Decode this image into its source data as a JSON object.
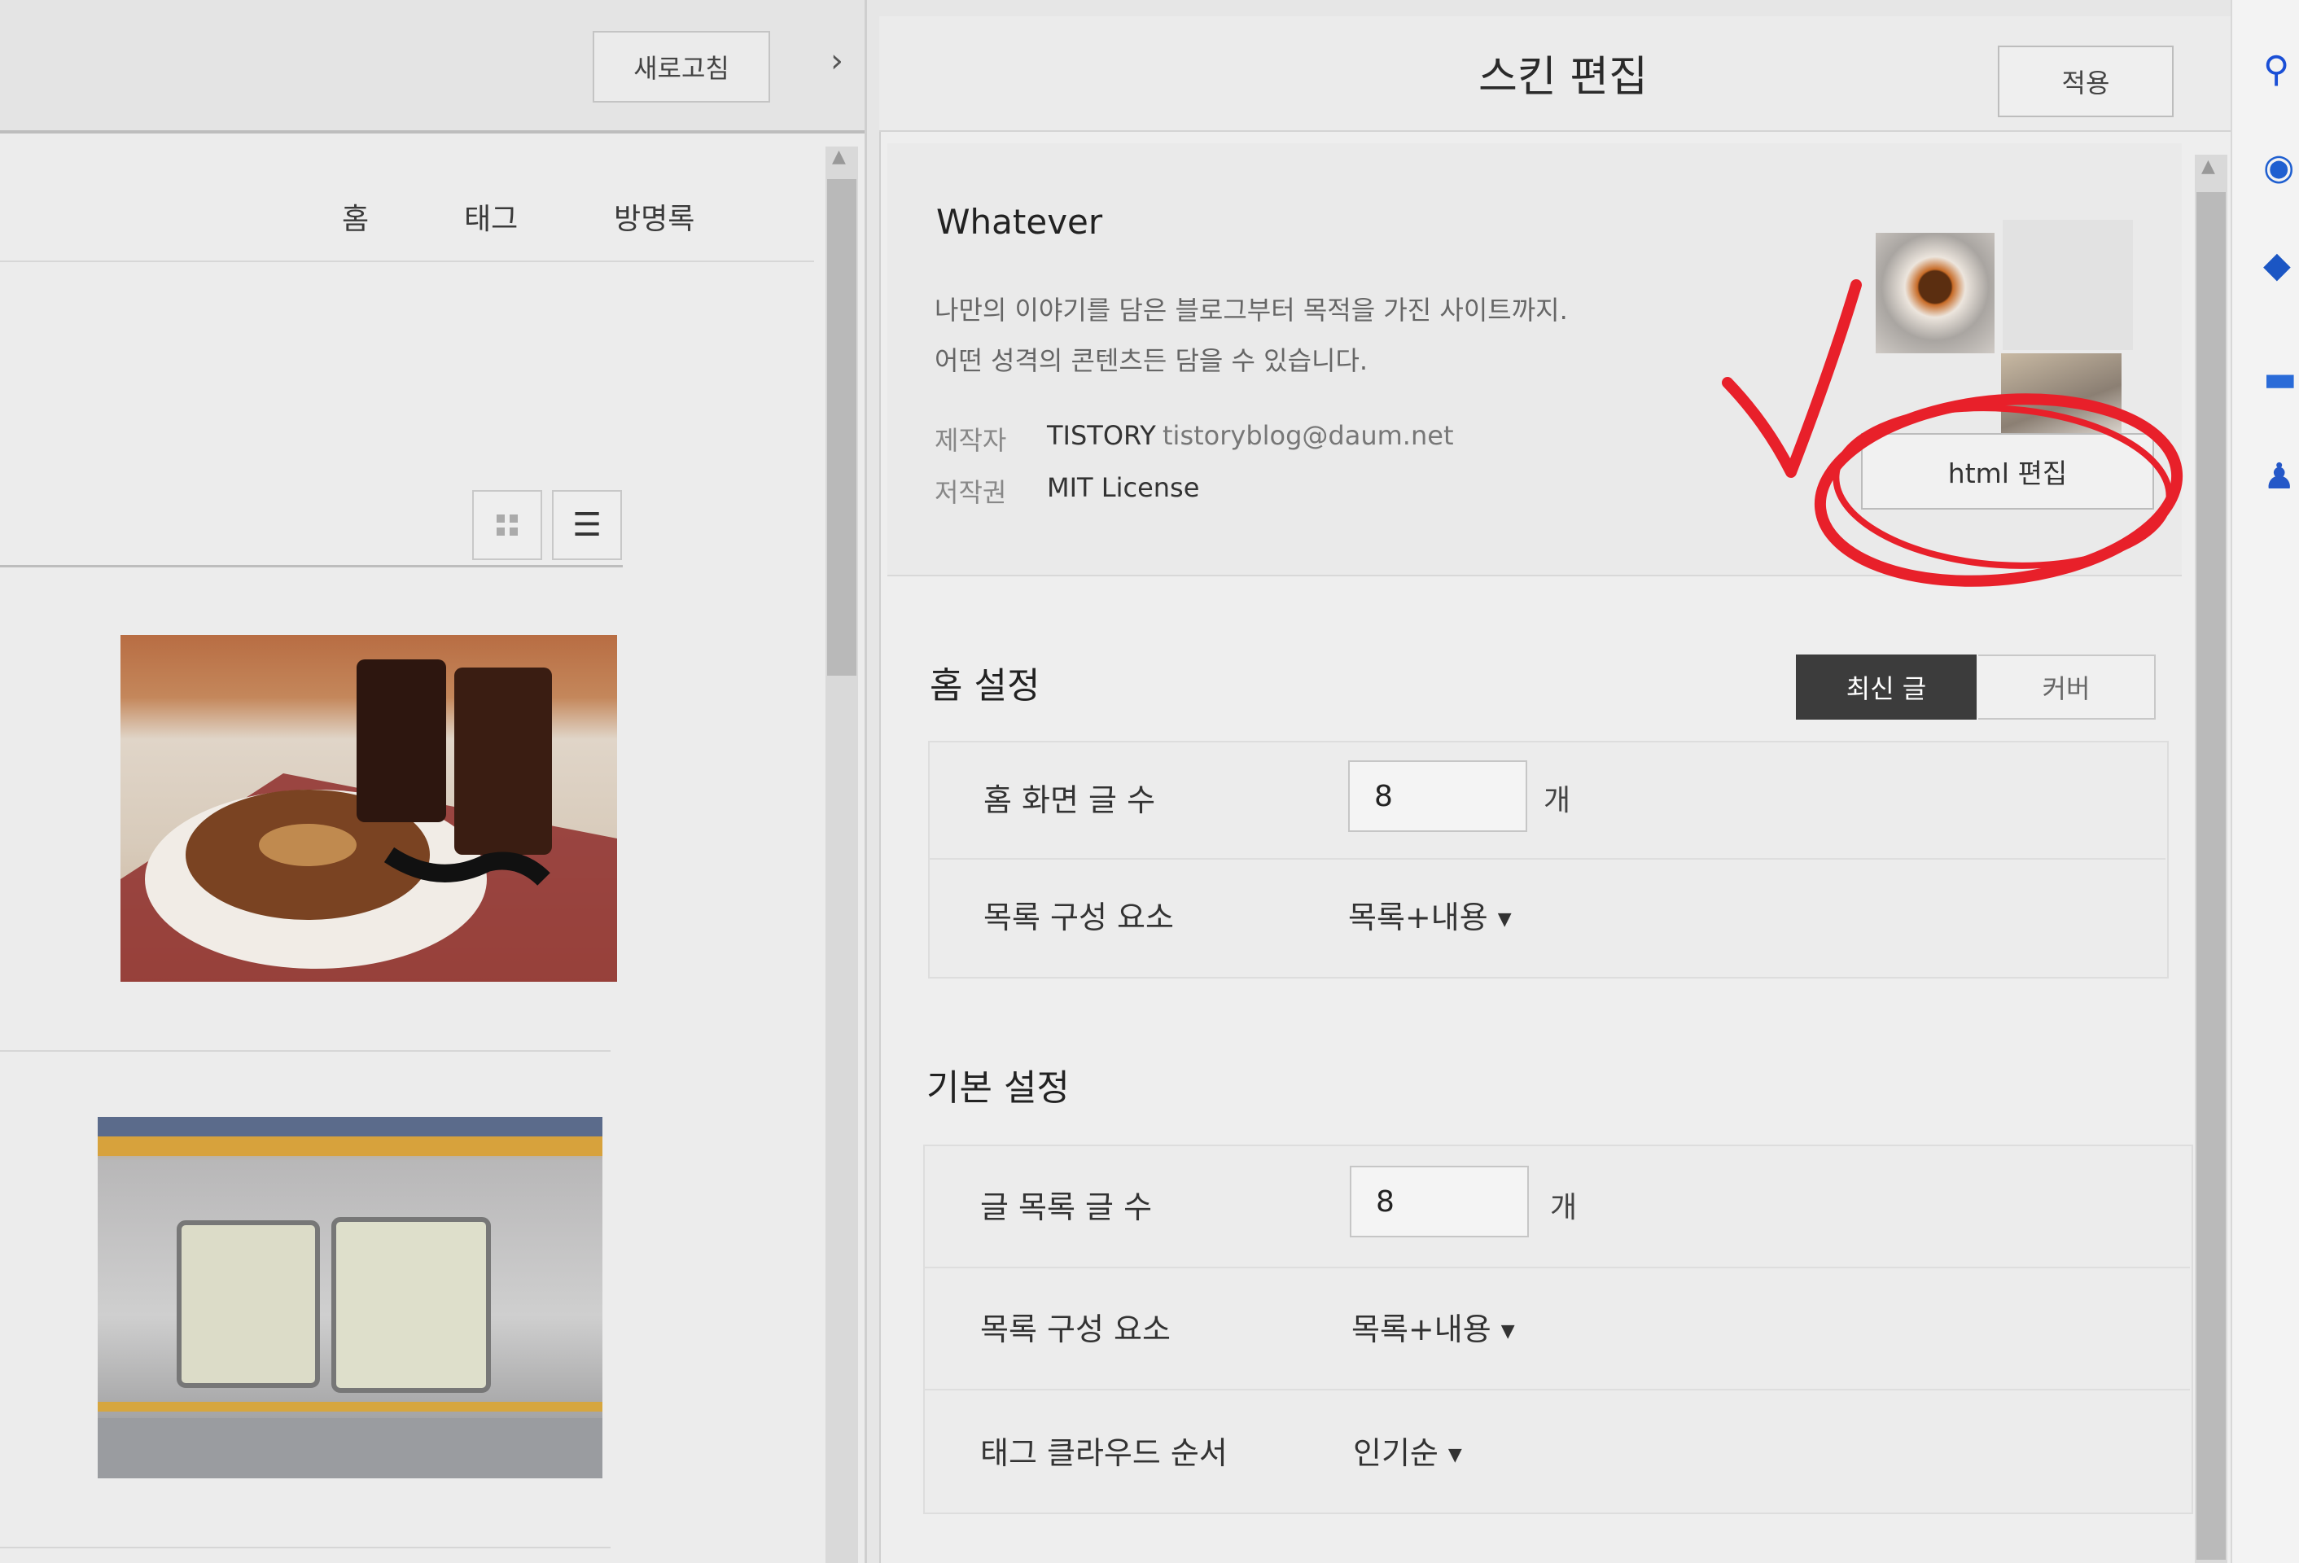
{
  "left": {
    "refresh_label": "새로고침",
    "collapse_icon": "chevron-right-icon",
    "nav": [
      "홈",
      "태그",
      "방명록"
    ],
    "view_grid_icon": "grid-icon",
    "view_list_icon": "list-icon"
  },
  "editor": {
    "title": "스킨 편집",
    "apply_label": "적용",
    "skin": {
      "name": "Whatever",
      "desc_line1": "나만의 이야기를 담은 블로그부터 목적을 가진 사이트까지.",
      "desc_line2": "어떤 성격의 콘텐츠든 담을 수 있습니다.",
      "author_label": "제작자",
      "author_value": "TISTORY",
      "author_email": "tistoryblog@daum.net",
      "copyright_label": "저작권",
      "copyright_value": "MIT License",
      "html_edit_label": "html 편집"
    },
    "home_settings": {
      "title": "홈 설정",
      "tabs": [
        "최신 글",
        "커버"
      ],
      "active_tab": "최신 글",
      "rows": [
        {
          "label": "홈 화면 글 수",
          "value": "8",
          "unit": "개"
        },
        {
          "label": "목록 구성 요소",
          "selected": "목록+내용"
        }
      ]
    },
    "basic_settings": {
      "title": "기본 설정",
      "rows": [
        {
          "label": "글 목록 글 수",
          "value": "8",
          "unit": "개"
        },
        {
          "label": "목록 구성 요소",
          "selected": "목록+내용"
        },
        {
          "label": "태그 클라우드 순서",
          "selected": "인기순"
        }
      ]
    }
  },
  "colors": {
    "active_tab_bg": "#3c3c3c",
    "annotation_red": "#e8202a"
  }
}
